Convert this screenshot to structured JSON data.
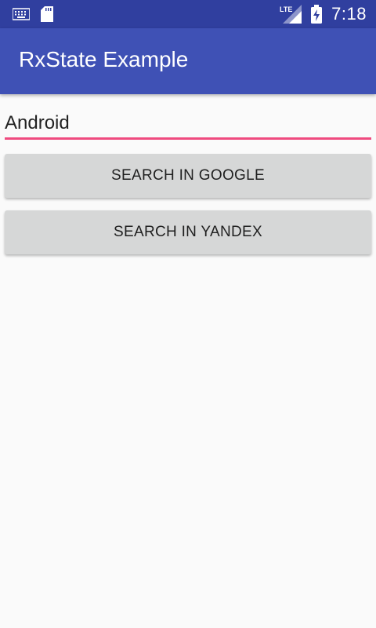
{
  "status_bar": {
    "network": "LTE",
    "time": "7:18",
    "icons": [
      "keyboard-icon",
      "sd-card-icon",
      "lte-signal-icon",
      "battery-charging-icon"
    ]
  },
  "app_bar": {
    "title": "RxState Example",
    "color": "#3f51b5"
  },
  "search": {
    "value": "Android",
    "underline_color": "#ef4a7f"
  },
  "buttons": {
    "google_label": "SEARCH IN GOOGLE",
    "yandex_label": "SEARCH IN YANDEX"
  }
}
